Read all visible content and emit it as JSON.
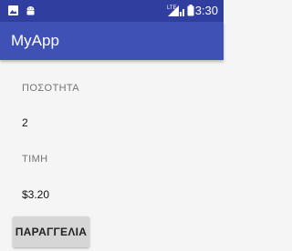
{
  "status_bar": {
    "time": "3:30",
    "left_icons": [
      "image-icon",
      "android-icon"
    ],
    "right_icons": [
      "lte-icon",
      "signal-icon",
      "battery-icon"
    ],
    "lte_label": "LTE"
  },
  "toolbar": {
    "title": "MyApp"
  },
  "quantity": {
    "label": "ΠΟΣΟΤΗΤΑ",
    "value": "2"
  },
  "price": {
    "label": "ΤΙΜΗ",
    "value": "$3.20"
  },
  "order_button": {
    "label": "ΠΑΡΑΓΓΕΛΙΑ"
  },
  "colors": {
    "status_bar": "#303f9f",
    "toolbar": "#3f51b5",
    "background": "#f5f5f5",
    "button": "#d6d6d6"
  }
}
